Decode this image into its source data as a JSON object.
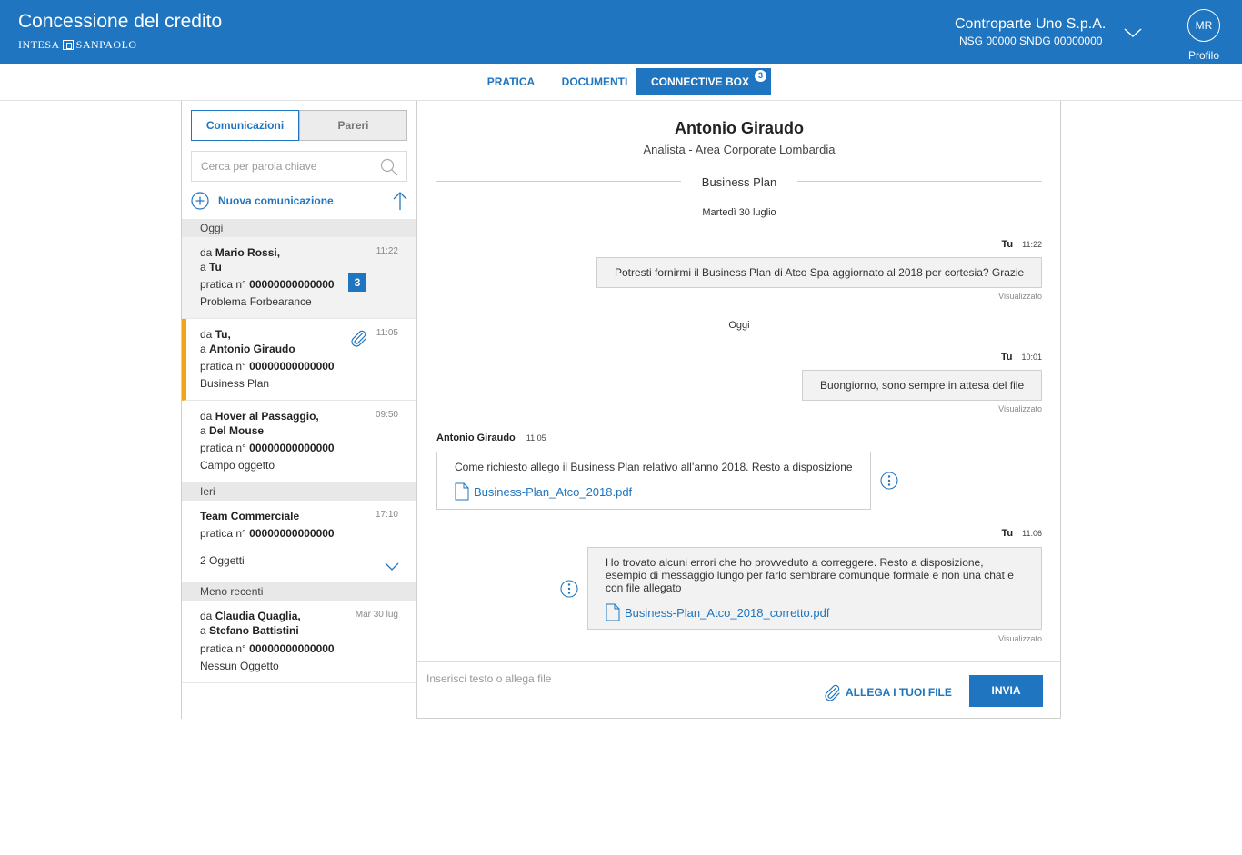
{
  "header": {
    "title": "Concessione del credito",
    "brand": "INTESA SANPAOLO",
    "brand_left": "INTESA",
    "brand_right": "SANPAOLO",
    "counterparty_name": "Controparte Uno S.p.A.",
    "counterparty_codes": "NSG 00000  SNDG 00000000",
    "avatar_initials": "MR",
    "profile_label": "Profilo",
    "primary_color": "#1f75bf"
  },
  "tabs": [
    {
      "label": "PRATICA",
      "active": false
    },
    {
      "label": "DOCUMENTI",
      "active": false
    },
    {
      "label": "CONNECTIVE BOX",
      "active": true,
      "badge": "3"
    }
  ],
  "sidebar": {
    "segments": [
      "Comunicazioni",
      "Pareri"
    ],
    "active_segment": "Comunicazioni",
    "search_placeholder": "Cerca per parola chiave",
    "new_label": "Nuova comunicazione",
    "groups": [
      {
        "label": "Oggi",
        "items": [
          {
            "from_prefix": "da",
            "from": "Mario Rossi,",
            "to_prefix": "a",
            "to": "Tu",
            "pratica_prefix": "pratica n°",
            "pratica": "00000000000000",
            "subject": "Problema Forbearance",
            "time": "11:22",
            "badge": "3",
            "selected": true
          },
          {
            "from_prefix": "da",
            "from": "Tu,",
            "to_prefix": "a",
            "to": "Antonio Giraudo",
            "pratica_prefix": "pratica n°",
            "pratica": "00000000000000",
            "subject": "Business Plan",
            "time": "11:05",
            "attachment": true,
            "active": true
          },
          {
            "from_prefix": "da",
            "from": "Hover al Passaggio,",
            "to_prefix": "a",
            "to": "Del Mouse",
            "pratica_prefix": "pratica n°",
            "pratica": "00000000000000",
            "subject": "Campo oggetto",
            "time": "09:50"
          }
        ]
      },
      {
        "label": "Ieri",
        "items": [
          {
            "from": "Team Commerciale",
            "pratica_prefix": "pratica n°",
            "pratica": "00000000000000",
            "subject": "2 Oggetti",
            "time": "17:10",
            "expandable": true
          }
        ]
      },
      {
        "label": "Meno recenti",
        "items": [
          {
            "from_prefix": "da",
            "from": "Claudia Quaglia,",
            "to_prefix": "a",
            "to": "Stefano Battistini",
            "pratica_prefix": "pratica n°",
            "pratica": "00000000000000",
            "subject": "Nessun Oggetto",
            "time": "Mar 30 lug"
          }
        ]
      }
    ]
  },
  "chat": {
    "contact_name": "Antonio Giraudo",
    "contact_role": "Analista - Area Corporate Lombardia",
    "subject": "Business Plan",
    "day1": "Martedì 30 luglio",
    "day2": "Oggi",
    "messages": [
      {
        "sender": "Tu",
        "time": "11:22",
        "text": "Potresti fornirmi il Business Plan di Atco Spa aggiornato al 2018 per cortesia? Grazie",
        "status": "Visualizzato"
      },
      {
        "sender": "Tu",
        "time": "10:01",
        "text": "Buongiorno, sono sempre in attesa del file",
        "status": "Visualizzato"
      },
      {
        "sender": "Antonio Giraudo",
        "time": "11:05",
        "text": "Come richiesto allego il Business Plan relativo all’anno 2018. Resto a disposizione",
        "attachment": "Business-Plan_Atco_2018.pdf"
      },
      {
        "sender": "Tu",
        "time": "11:06",
        "text_lines": [
          "Ho trovato alcuni errori che ho provveduto a correggere. Resto a disposizione,",
          "esempio di messaggio lungo per farlo sembrare comunque formale e non una chat e",
          "con file allegato"
        ],
        "attachment": "Business-Plan_Atco_2018_corretto.pdf",
        "status": "Visualizzato"
      }
    ],
    "composer_placeholder": "Inserisci testo o allega file",
    "attach_label": "ALLEGA I TUOI FILE",
    "send_label": "INVIA"
  },
  "accent_color": "#f5a31a"
}
